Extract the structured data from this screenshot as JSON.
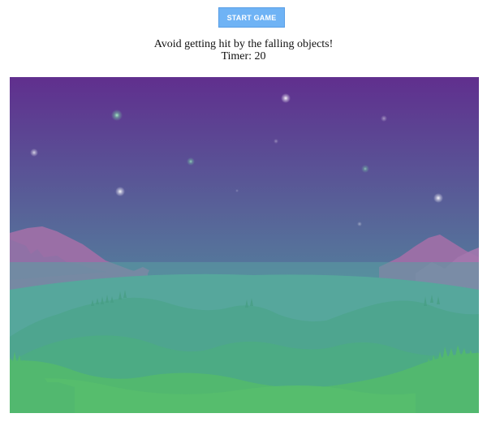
{
  "controls": {
    "start_label": "START GAME"
  },
  "instructions": {
    "text": "Avoid getting hit by the falling objects!"
  },
  "timer": {
    "label": "Timer:",
    "value": 20,
    "display": "Timer: 20"
  },
  "scene": {
    "sky_top_color": "#5f2f8f",
    "sky_bottom_color": "#4f9aa0",
    "foreground_color": "#52b86f",
    "star_count": 12
  },
  "colors": {
    "button_bg": "#6fb3f5",
    "button_text": "#ffffff"
  }
}
